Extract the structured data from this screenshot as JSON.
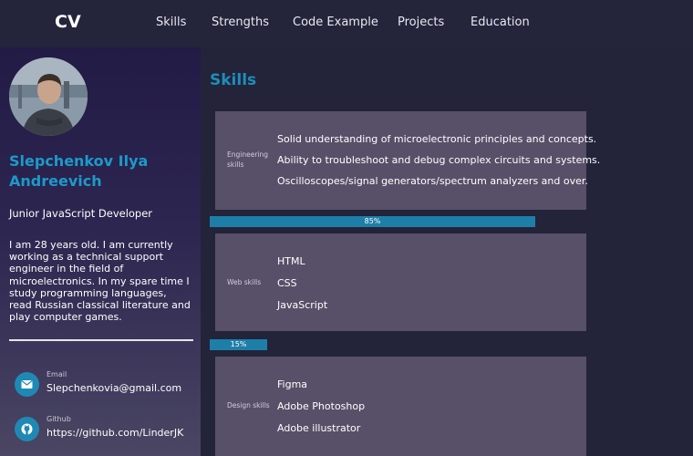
{
  "header": {
    "logo": "CV",
    "nav": [
      "Skills",
      "Strengths",
      "Code Example",
      "Projects",
      "Education"
    ]
  },
  "sidebar": {
    "name": "Slepchenkov Ilya Andreevich",
    "role": "Junior JavaScript Developer",
    "about": "I am 28 years old. I am currently working as a technical support engineer in the field of microelectronics. In my spare time I study programming languages, read Russian classical literature and play computer games.",
    "contacts": [
      {
        "label": "Email",
        "value": "Slepchenkovia@gmail.com",
        "icon": "mail-icon"
      },
      {
        "label": "Github",
        "value": "https://github.com/LinderJK",
        "icon": "github-icon"
      }
    ]
  },
  "main": {
    "section_title": "Skills",
    "cards": [
      {
        "category": "Engineering skills",
        "items": [
          "Solid understanding of microelectronic principles and concepts.",
          "Ability to troubleshoot and debug complex circuits and systems.",
          "Oscilloscopes/signal generators/spectrum analyzers and over."
        ]
      },
      {
        "category": "Web skills",
        "items": [
          "HTML",
          "CSS",
          "JavaScript"
        ]
      },
      {
        "category": "Design skills",
        "items": [
          "Figma",
          "Adobe Photoshop",
          "Adobe illustrator"
        ]
      }
    ],
    "bars": [
      {
        "label": "85%",
        "value": 0.85
      },
      {
        "label": "15%",
        "value": 0.15
      }
    ]
  },
  "colors": {
    "accent": "#1c9ac9",
    "background": "#23233a",
    "card": "#585068"
  }
}
